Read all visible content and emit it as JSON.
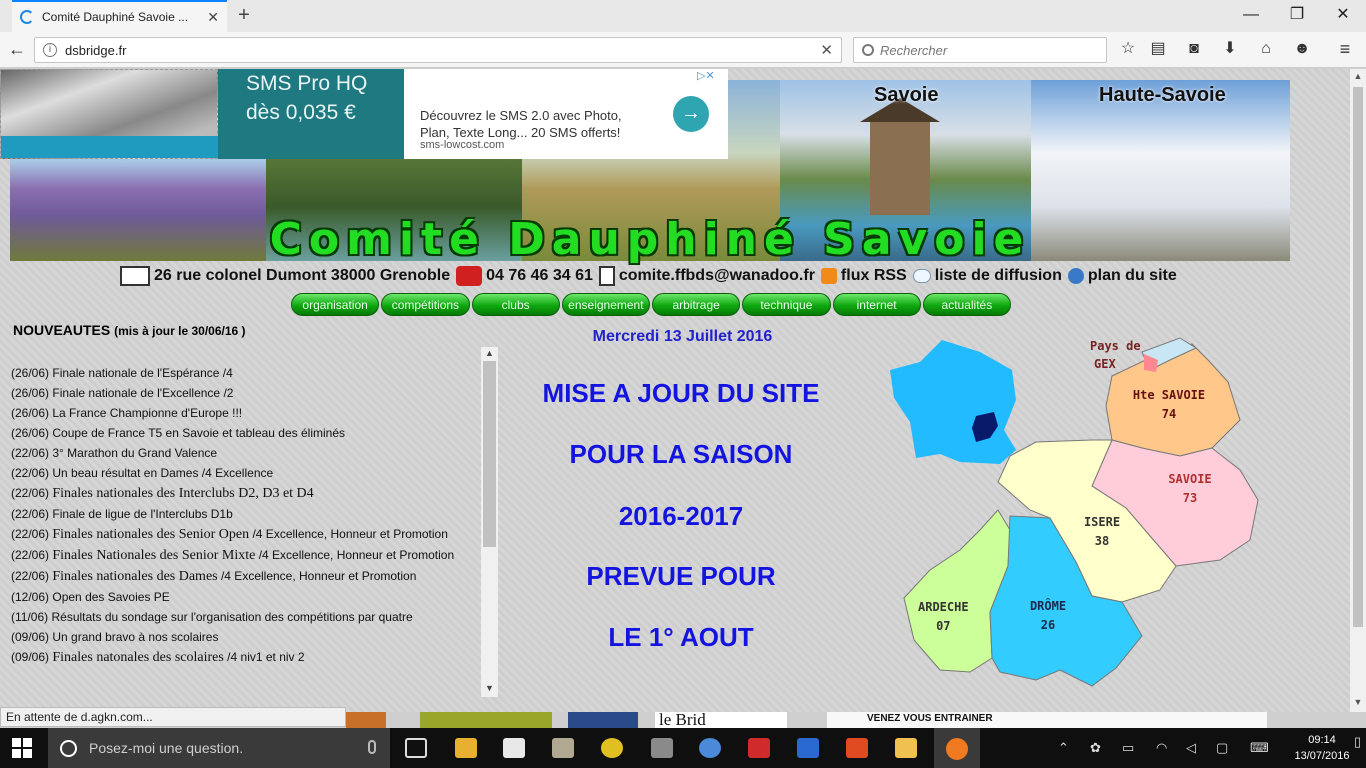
{
  "browser": {
    "tab_title": "Comité Dauphiné Savoie ...",
    "tab_close": "✕",
    "new_tab": "+",
    "url": "dsbridge.fr",
    "search_placeholder": "Rechercher",
    "status": "En attente de d.agkn.com..."
  },
  "ad": {
    "line1": "SMS Pro HQ",
    "line2": "dès 0,035 €",
    "description": "Découvrez le SMS 2.0 avec Photo, Plan, Texte Long... 20 SMS offerts!",
    "source": "sms-lowcost.com"
  },
  "banner": {
    "title": "Comité Dauphiné Savoie",
    "label_savoie": "Savoie",
    "label_haute_savoie": "Haute-Savoie"
  },
  "contact": {
    "address": "26 rue colonel Dumont 38000 Grenoble",
    "phone": "04 76 46 34 61",
    "email": "comite.ffbds@wanadoo.fr",
    "rss": "flux RSS",
    "mailing": "liste de diffusion",
    "sitemap": "plan du site"
  },
  "nav": [
    "organisation",
    "compétitions",
    "clubs",
    "enseignement",
    "arbitrage",
    "technique",
    "internet",
    "actualités"
  ],
  "news": {
    "title": "NOUVEAUTES",
    "updated": "(mis à jour le 30/06/16 )",
    "items": [
      {
        "date": "(26/06)",
        "big": "",
        "text": "Finale nationale de l'Espérance /4"
      },
      {
        "date": "(26/06)",
        "big": "",
        "text": "Finale nationale de l'Excellence /2"
      },
      {
        "date": "(26/06)",
        "big": "",
        "text": "La France Championne d'Europe !!!"
      },
      {
        "date": "(26/06)",
        "big": "",
        "text": "Coupe de France T5 en Savoie et tableau des éliminés"
      },
      {
        "date": "(22/06)",
        "big": "",
        "text": "3° Marathon du Grand Valence"
      },
      {
        "date": "(22/06)",
        "big": "",
        "text": "Un beau résultat en Dames /4 Excellence"
      },
      {
        "date": "(22/06)",
        "big": "Finales nationales des Interclubs D2, D3 et D4",
        "text": ""
      },
      {
        "date": "(22/06)",
        "big": "",
        "text": "Finale de ligue de l'Interclubs D1b"
      },
      {
        "date": "(22/06)",
        "big": "Finales nationales des Senior Open",
        "text": "/4 Excellence, Honneur et Promotion"
      },
      {
        "date": "(22/06)",
        "big": "Finales Nationales des Senior Mixte",
        "text": "/4 Excellence, Honneur et Promotion"
      },
      {
        "date": "(22/06)",
        "big": "Finales nationales des Dames",
        "text": "/4 Excellence, Honneur et Promotion"
      },
      {
        "date": "(12/06)",
        "big": "",
        "text": "Open des Savoies PE"
      },
      {
        "date": "(11/06)",
        "big": "",
        "text": "Résultats du sondage sur l'organisation des compétitions par quatre"
      },
      {
        "date": "(09/06)",
        "big": "",
        "text": "Un grand bravo à nos scolaires"
      },
      {
        "date": "(09/06)",
        "big": "Finales natonales des scolaires",
        "text": "/4 niv1 et niv 2"
      }
    ]
  },
  "main": {
    "date": "Mercredi 13 Juillet 2016",
    "lines": [
      "MISE A JOUR DU SITE",
      "POUR LA SAISON",
      "2016-2017",
      "PREVUE POUR",
      "LE 1° AOUT"
    ]
  },
  "map": {
    "gex_1": "Pays de",
    "gex_2": "GEX",
    "hte_savoie": "Hte SAVOIE",
    "hte_savoie_num": "74",
    "savoie": "SAVOIE",
    "savoie_num": "73",
    "isere": "ISERE",
    "isere_num": "38",
    "ardeche": "ARDECHE",
    "ardeche_num": "07",
    "drome": "DRÔME",
    "drome_num": "26",
    "colors": {
      "france": "#22bbff",
      "hte_savoie": "#ffc78a",
      "savoie": "#ffccd9",
      "isere": "#ffffcc",
      "ardeche": "#ccff99",
      "drome": "#33ccff"
    }
  },
  "bottom_strip": {
    "ad_text": "VENEZ VOUS ENTRAINER",
    "partner": "le Brid"
  },
  "taskbar": {
    "search": "Posez-moi une question.",
    "time": "09:14",
    "date": "13/07/2016"
  }
}
